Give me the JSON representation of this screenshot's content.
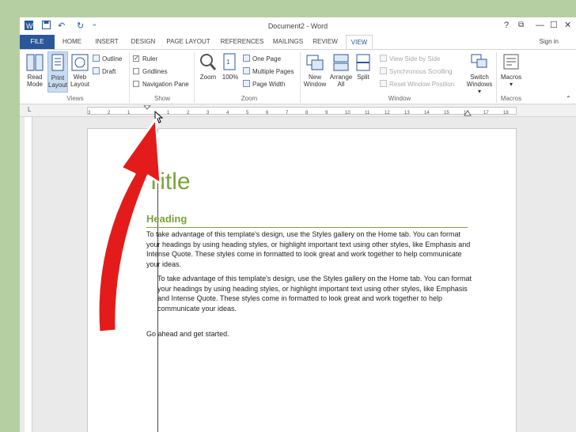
{
  "window": {
    "title": "Document2 - Word",
    "help": "?",
    "restore": "⧉",
    "minimize": "—",
    "maximize": "☐",
    "close": "✕",
    "sign_in": "Sign in"
  },
  "quick_access": {
    "save": "💾",
    "undo": "↶",
    "redo": "↻",
    "more": "⁼"
  },
  "tabs": [
    "FILE",
    "HOME",
    "INSERT",
    "DESIGN",
    "PAGE LAYOUT",
    "REFERENCES",
    "MAILINGS",
    "REVIEW",
    "VIEW"
  ],
  "ribbon": {
    "views": {
      "label": "Views",
      "read_mode": [
        "Read",
        "Mode"
      ],
      "print_layout": [
        "Print",
        "Layout"
      ],
      "web_layout": [
        "Web",
        "Layout"
      ],
      "outline": "Outline",
      "draft": "Draft"
    },
    "show": {
      "label": "Show",
      "ruler": "Ruler",
      "ruler_checked": true,
      "gridlines": "Gridlines",
      "navigation_pane": "Navigation Pane"
    },
    "zoom": {
      "label": "Zoom",
      "zoom": "Zoom",
      "hundred": "100%",
      "one_page": "One Page",
      "multiple_pages": "Multiple Pages",
      "page_width": "Page Width"
    },
    "window": {
      "label": "Window",
      "new_window": [
        "New",
        "Window"
      ],
      "arrange_all": [
        "Arrange",
        "All"
      ],
      "split": "Split",
      "view_side_by_side": "View Side by Side",
      "synchronous_scrolling": "Synchronous Scrolling",
      "reset_window_position": "Reset Window Position",
      "switch_windows": [
        "Switch",
        "Windows ▾"
      ]
    },
    "macros": {
      "label": "Macros",
      "macros": "Macros",
      "dropdown": "▾"
    },
    "collapse": "⌃"
  },
  "ruler": {
    "corner": "L",
    "ticks": [
      "3",
      "2",
      "1",
      "1",
      "2",
      "3",
      "4",
      "5",
      "6",
      "7",
      "8",
      "9",
      "10",
      "11",
      "12",
      "13",
      "14",
      "15",
      "16",
      "17",
      "18"
    ]
  },
  "document": {
    "title": "Title",
    "heading": "Heading",
    "para1": "To take advantage of this template's design, use the Styles gallery on the Home tab. You can format your headings by using heading styles, or highlight important text using other styles, like Emphasis and Intense Quote. These styles come in formatted to look great and work together to help communicate your ideas.",
    "para2": "To take advantage of this template's design, use the Styles gallery on the Home tab. You can format your headings by using heading styles, or highlight important text using other styles, like Emphasis and Intense Quote. These styles come in formatted to look great and work together to help communicate your ideas.",
    "para3": "Go ahead and get started."
  },
  "colors": {
    "file_tab": "#2b579a",
    "heading": "#7aa33b",
    "annotation_arrow": "#e31b1b",
    "backdrop": "#b5cfa2"
  }
}
